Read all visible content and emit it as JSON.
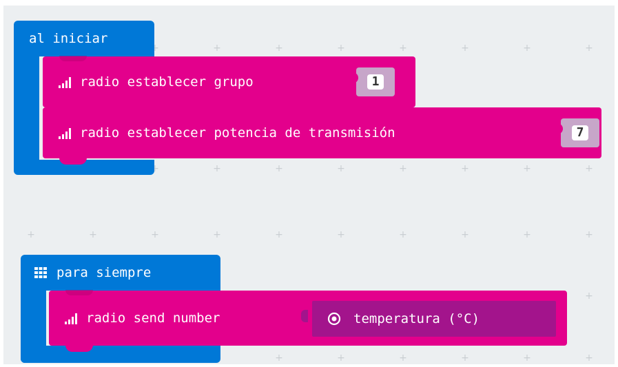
{
  "blocks": {
    "on_start": {
      "label": "al iniciar",
      "color": "#0078d7",
      "statements": [
        {
          "text": "radio establecer grupo",
          "value": "1",
          "icon": "signal-bars-icon"
        },
        {
          "text": "radio establecer potencia de transmisión",
          "value": "7",
          "icon": "signal-bars-icon"
        }
      ]
    },
    "forever": {
      "label": "para siempre",
      "icon": "grid-icon",
      "color": "#0078d7",
      "statements": [
        {
          "text": "radio send number",
          "icon": "signal-bars-icon",
          "reporter": {
            "text": "temperatura (°C)",
            "icon": "target-icon"
          }
        }
      ]
    }
  },
  "colors": {
    "radio_block": "#e3008c",
    "event_block": "#0078d7",
    "reporter": "#a3148c",
    "workspace": "#eceff1"
  }
}
